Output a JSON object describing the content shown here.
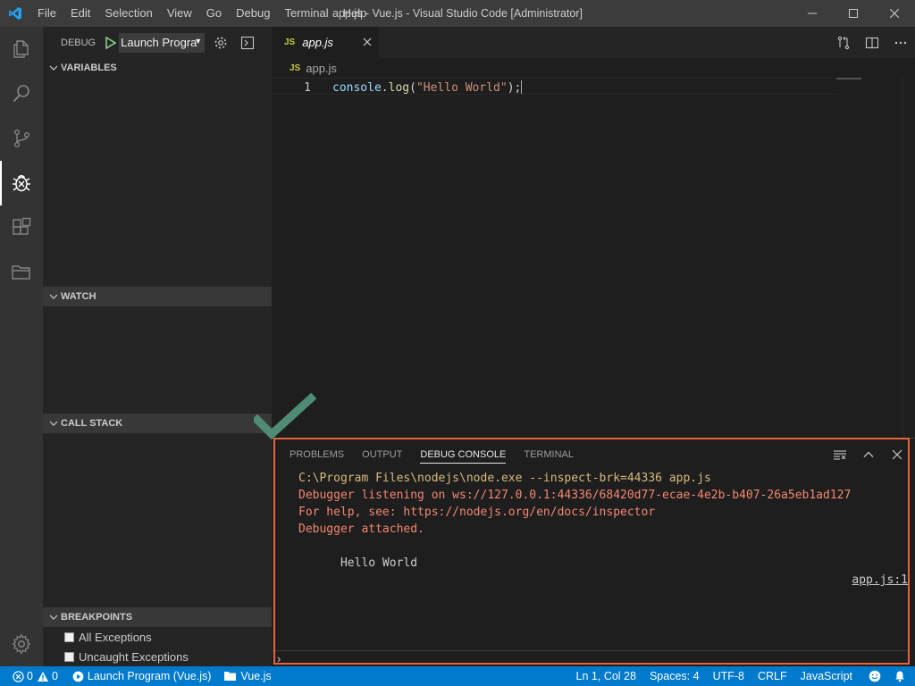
{
  "titlebar": {
    "menu": [
      "File",
      "Edit",
      "Selection",
      "View",
      "Go",
      "Debug",
      "Terminal",
      "Help"
    ],
    "title": "app.js - Vue.js - Visual Studio Code [Administrator]"
  },
  "activitybar": {
    "items": [
      "explorer-icon",
      "search-icon",
      "source-control-icon",
      "debug-icon",
      "extensions-icon",
      "folder-icon"
    ],
    "active": "debug-icon",
    "bottom": "gear-icon"
  },
  "sidebar": {
    "debug_label": "DEBUG",
    "config": "Launch Progra",
    "sections": {
      "variables": "VARIABLES",
      "watch": "WATCH",
      "callstack": "CALL STACK",
      "breakpoints": "BREAKPOINTS"
    },
    "breakpoints": [
      "All Exceptions",
      "Uncaught Exceptions"
    ]
  },
  "editor": {
    "tab": {
      "badge": "JS",
      "name": "app.js"
    },
    "breadcrumb": {
      "badge": "JS",
      "name": "app.js"
    },
    "lines": [
      {
        "num": "1",
        "obj": "console",
        "dot": ".",
        "fn": "log",
        "open": "(",
        "str": "\"Hello World\"",
        "close": ");"
      }
    ]
  },
  "panel": {
    "tabs": [
      "PROBLEMS",
      "OUTPUT",
      "DEBUG CONSOLE",
      "TERMINAL"
    ],
    "active_tab": "DEBUG CONSOLE",
    "output": {
      "cmd": "C:\\Program Files\\nodejs\\node.exe --inspect-brk=44336 app.js",
      "err1": "Debugger listening on ws://127.0.0.1:44336/68420d77-ecae-4e2b-b407-26a5eb1ad127",
      "err2": "For help, see: https://nodejs.org/en/docs/inspector",
      "err3": "Debugger attached.",
      "log": "Hello World",
      "log_src": "app.js:1"
    },
    "prompt": "›"
  },
  "statusbar": {
    "errors": "0",
    "warnings": "0",
    "launch": "Launch Program (Vue.js)",
    "folder": "Vue.js",
    "position": "Ln 1, Col 28",
    "spaces": "Spaces: 4",
    "encoding": "UTF-8",
    "eol": "CRLF",
    "language": "JavaScript"
  },
  "colors": {
    "accent": "#007acc",
    "highlight_border": "#e8623a",
    "checkmark": "#4e8c74"
  }
}
